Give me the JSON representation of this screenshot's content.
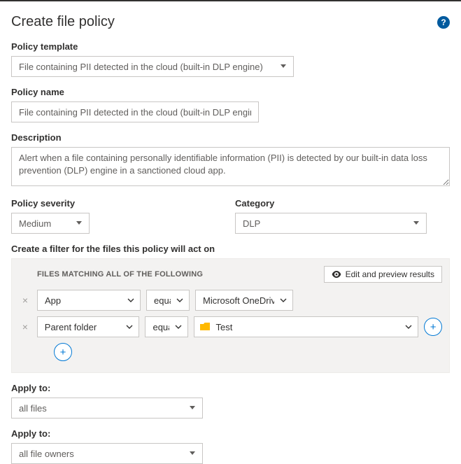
{
  "header": {
    "title": "Create file policy",
    "help": "?"
  },
  "template": {
    "label": "Policy template",
    "value": "File containing PII detected in the cloud (built-in DLP engine)"
  },
  "name": {
    "label": "Policy name",
    "value": "File containing PII detected in the cloud (built-in DLP engine)"
  },
  "description": {
    "label": "Description",
    "value": "Alert when a file containing personally identifiable information (PII) is detected by our built-in data loss prevention (DLP) engine in a sanctioned cloud app."
  },
  "severity": {
    "label": "Policy severity",
    "value": "Medium"
  },
  "category": {
    "label": "Category",
    "value": "DLP"
  },
  "filter": {
    "section_label": "Create a filter for the files this policy will act on",
    "caption": "FILES MATCHING ALL OF THE FOLLOWING",
    "edit_preview_label": "Edit and preview results",
    "rows": [
      {
        "field": "App",
        "op": "equals",
        "value": "Microsoft OneDrive fo..."
      },
      {
        "field": "Parent folder",
        "op": "equals",
        "value": "Test"
      }
    ],
    "add_label": "+"
  },
  "apply1": {
    "label": "Apply to:",
    "value": "all files"
  },
  "apply2": {
    "label": "Apply to:",
    "value": "all file owners"
  }
}
